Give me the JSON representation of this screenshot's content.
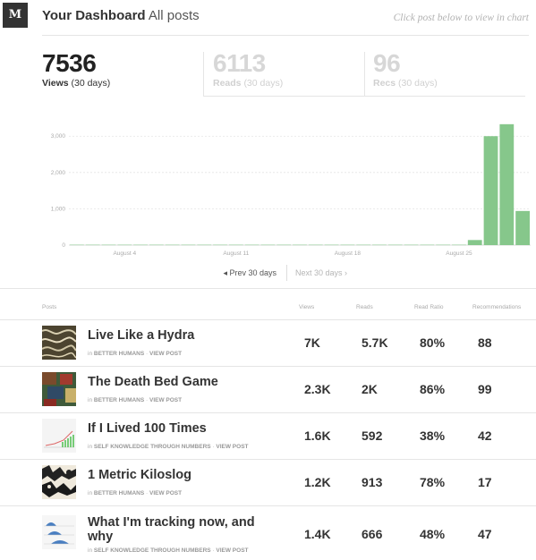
{
  "header": {
    "logo": "M",
    "title": "Your Dashboard",
    "subtitle": "All posts",
    "hint": "Click post below to view in chart"
  },
  "stats": [
    {
      "value": "7536",
      "label_bold": "Views",
      "label_rest": "(30 days)",
      "active": true
    },
    {
      "value": "6113",
      "label_bold": "Reads",
      "label_rest": "(30 days)",
      "active": false
    },
    {
      "value": "96",
      "label_bold": "Recs",
      "label_rest": "(30 days)",
      "active": false
    }
  ],
  "chart_data": {
    "type": "bar",
    "series": [
      {
        "values": [
          10,
          10,
          10,
          10,
          10,
          10,
          10,
          10,
          10,
          10,
          10,
          10,
          10,
          10,
          10,
          10,
          10,
          10,
          10,
          10,
          10,
          10,
          10,
          10,
          10,
          140,
          3000,
          3330,
          940
        ]
      }
    ],
    "x_ticks": [
      "August 4",
      "August 11",
      "August 18",
      "August 25"
    ],
    "x_tick_positions": [
      4,
      11,
      18,
      25
    ],
    "y_ticks": [
      "3,000",
      "2,000",
      "1,000",
      "0"
    ],
    "y_tick_values": [
      3000,
      2000,
      1000,
      0
    ],
    "ylim": [
      0,
      3400
    ],
    "grid": true,
    "color": "#86c78b"
  },
  "pager": {
    "prev": "Prev 30 days",
    "next": "Next 30 days"
  },
  "table": {
    "headers": [
      "Posts",
      "Views",
      "Reads",
      "Read Ratio",
      "Recommendations"
    ],
    "rows": [
      {
        "title": "Live Like a Hydra",
        "in": "in",
        "publication": "BETTER HUMANS",
        "view": "VIEW POST",
        "views": "7K",
        "reads": "5.7K",
        "ratio": "80%",
        "recs": "88"
      },
      {
        "title": "The Death Bed Game",
        "in": "in",
        "publication": "BETTER HUMANS",
        "view": "VIEW POST",
        "views": "2.3K",
        "reads": "2K",
        "ratio": "86%",
        "recs": "99"
      },
      {
        "title": "If I Lived 100 Times",
        "in": "in",
        "publication": "SELF KNOWLEDGE THROUGH NUMBERS",
        "view": "VIEW POST",
        "views": "1.6K",
        "reads": "592",
        "ratio": "38%",
        "recs": "42"
      },
      {
        "title": "1 Metric Kiloslog",
        "in": "in",
        "publication": "BETTER HUMANS",
        "view": "VIEW POST",
        "views": "1.2K",
        "reads": "913",
        "ratio": "78%",
        "recs": "17"
      },
      {
        "title": "What I'm tracking now, and why",
        "in": "in",
        "publication": "SELF KNOWLEDGE THROUGH NUMBERS",
        "view": "VIEW POST",
        "views": "1.4K",
        "reads": "666",
        "ratio": "48%",
        "recs": "47"
      }
    ]
  }
}
